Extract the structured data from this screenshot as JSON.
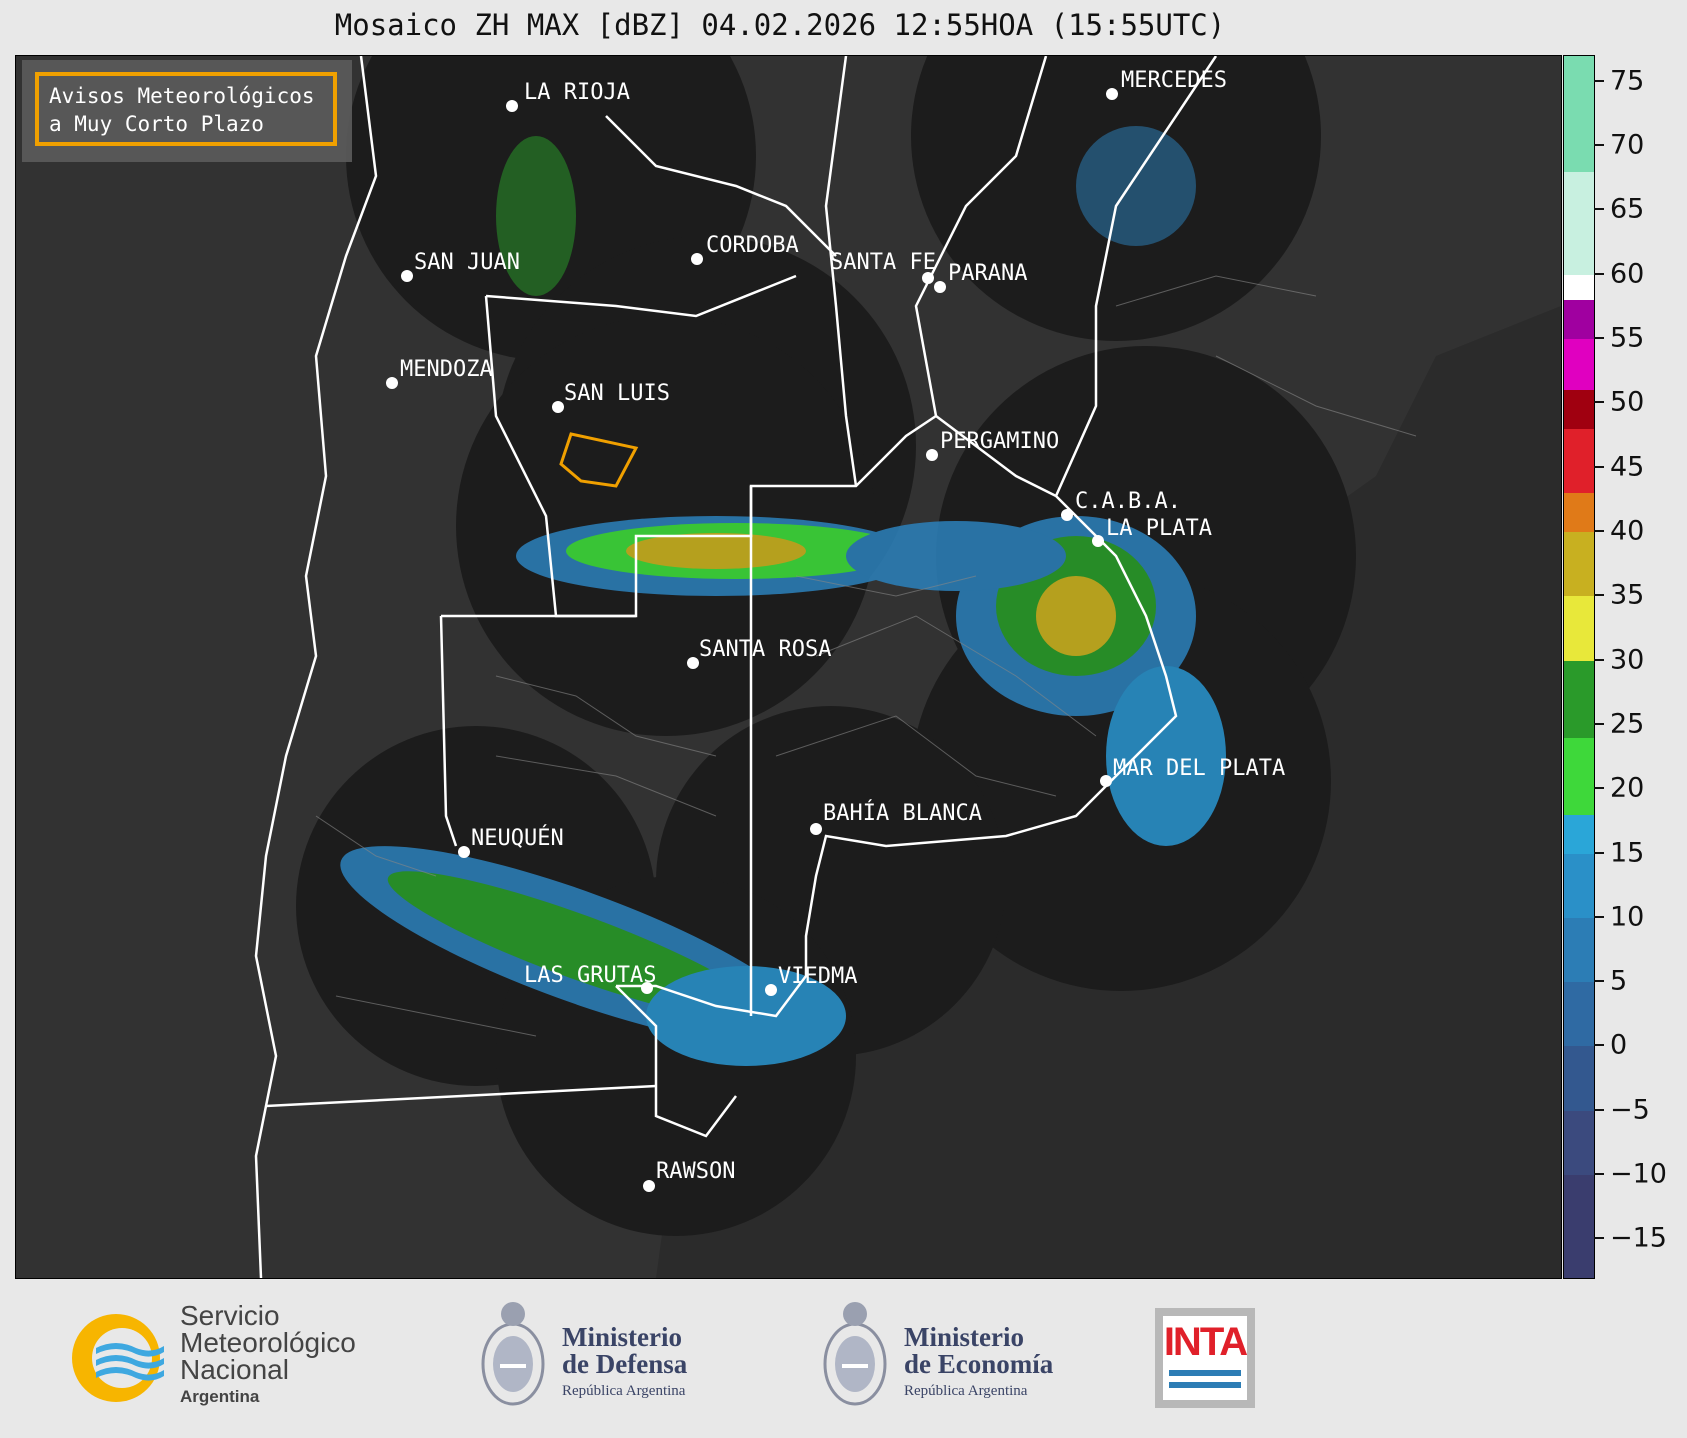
{
  "title": "Mosaico ZH MAX [dBZ] 04.02.2026 12:55HOA (15:55UTC)",
  "notice": {
    "line1": "Avisos Meteorológicos",
    "line2": "a Muy Corto Plazo",
    "border_color": "#f0a000"
  },
  "cities": [
    {
      "name": "LA RIOJA"
    },
    {
      "name": "MERCEDES"
    },
    {
      "name": "CORDOBA"
    },
    {
      "name": "SAN JUAN"
    },
    {
      "name": "SANTA FE"
    },
    {
      "name": "PARANA"
    },
    {
      "name": "MENDOZA"
    },
    {
      "name": "SAN LUIS"
    },
    {
      "name": "PERGAMINO"
    },
    {
      "name": "C.A.B.A."
    },
    {
      "name": "LA PLATA"
    },
    {
      "name": "SANTA ROSA"
    },
    {
      "name": "MAR DEL PLATA"
    },
    {
      "name": "BAHÍA BLANCA"
    },
    {
      "name": "NEUQUÉN"
    },
    {
      "name": "LAS GRUTAS"
    },
    {
      "name": "VIEDMA"
    },
    {
      "name": "RAWSON"
    }
  ],
  "colorbar": {
    "unit": "dBZ",
    "ticks": [
      "75",
      "70",
      "65",
      "60",
      "55",
      "50",
      "45",
      "40",
      "35",
      "30",
      "25",
      "20",
      "15",
      "10",
      "5",
      "0",
      "−5",
      "−10",
      "−15"
    ],
    "range": [
      -18,
      77
    ],
    "stops": [
      {
        "from": -18,
        "to": -10,
        "color": "#3a3d6e"
      },
      {
        "from": -10,
        "to": -5,
        "color": "#3b4a7e"
      },
      {
        "from": -5,
        "to": 0,
        "color": "#33588f"
      },
      {
        "from": 0,
        "to": 5,
        "color": "#2f6aa3"
      },
      {
        "from": 5,
        "to": 10,
        "color": "#2c7db5"
      },
      {
        "from": 10,
        "to": 15,
        "color": "#2a90c8"
      },
      {
        "from": 15,
        "to": 18,
        "color": "#2aa6d8"
      },
      {
        "from": 18,
        "to": 24,
        "color": "#3ed83a"
      },
      {
        "from": 24,
        "to": 30,
        "color": "#2a9a2a"
      },
      {
        "from": 30,
        "to": 35,
        "color": "#e8e83a"
      },
      {
        "from": 35,
        "to": 40,
        "color": "#c8b020"
      },
      {
        "from": 40,
        "to": 43,
        "color": "#e07a18"
      },
      {
        "from": 43,
        "to": 48,
        "color": "#e0202a"
      },
      {
        "from": 48,
        "to": 51,
        "color": "#a00010"
      },
      {
        "from": 51,
        "to": 55,
        "color": "#e000c0"
      },
      {
        "from": 55,
        "to": 58,
        "color": "#a000a0"
      },
      {
        "from": 58,
        "to": 60,
        "color": "#ffffff"
      },
      {
        "from": 60,
        "to": 68,
        "color": "#c8f0e0"
      },
      {
        "from": 68,
        "to": 77,
        "color": "#7adcb0"
      }
    ]
  },
  "logos": {
    "smn": {
      "line1": "Servicio",
      "line2": "Meteorológico",
      "line3": "Nacional",
      "line4": "Argentina"
    },
    "defensa": {
      "line1": "Ministerio",
      "line2": "de Defensa",
      "line3": "República Argentina"
    },
    "economia": {
      "line1": "Ministerio",
      "line2": "de Economía",
      "line3": "República Argentina"
    },
    "inta": {
      "text": "INTA"
    }
  }
}
